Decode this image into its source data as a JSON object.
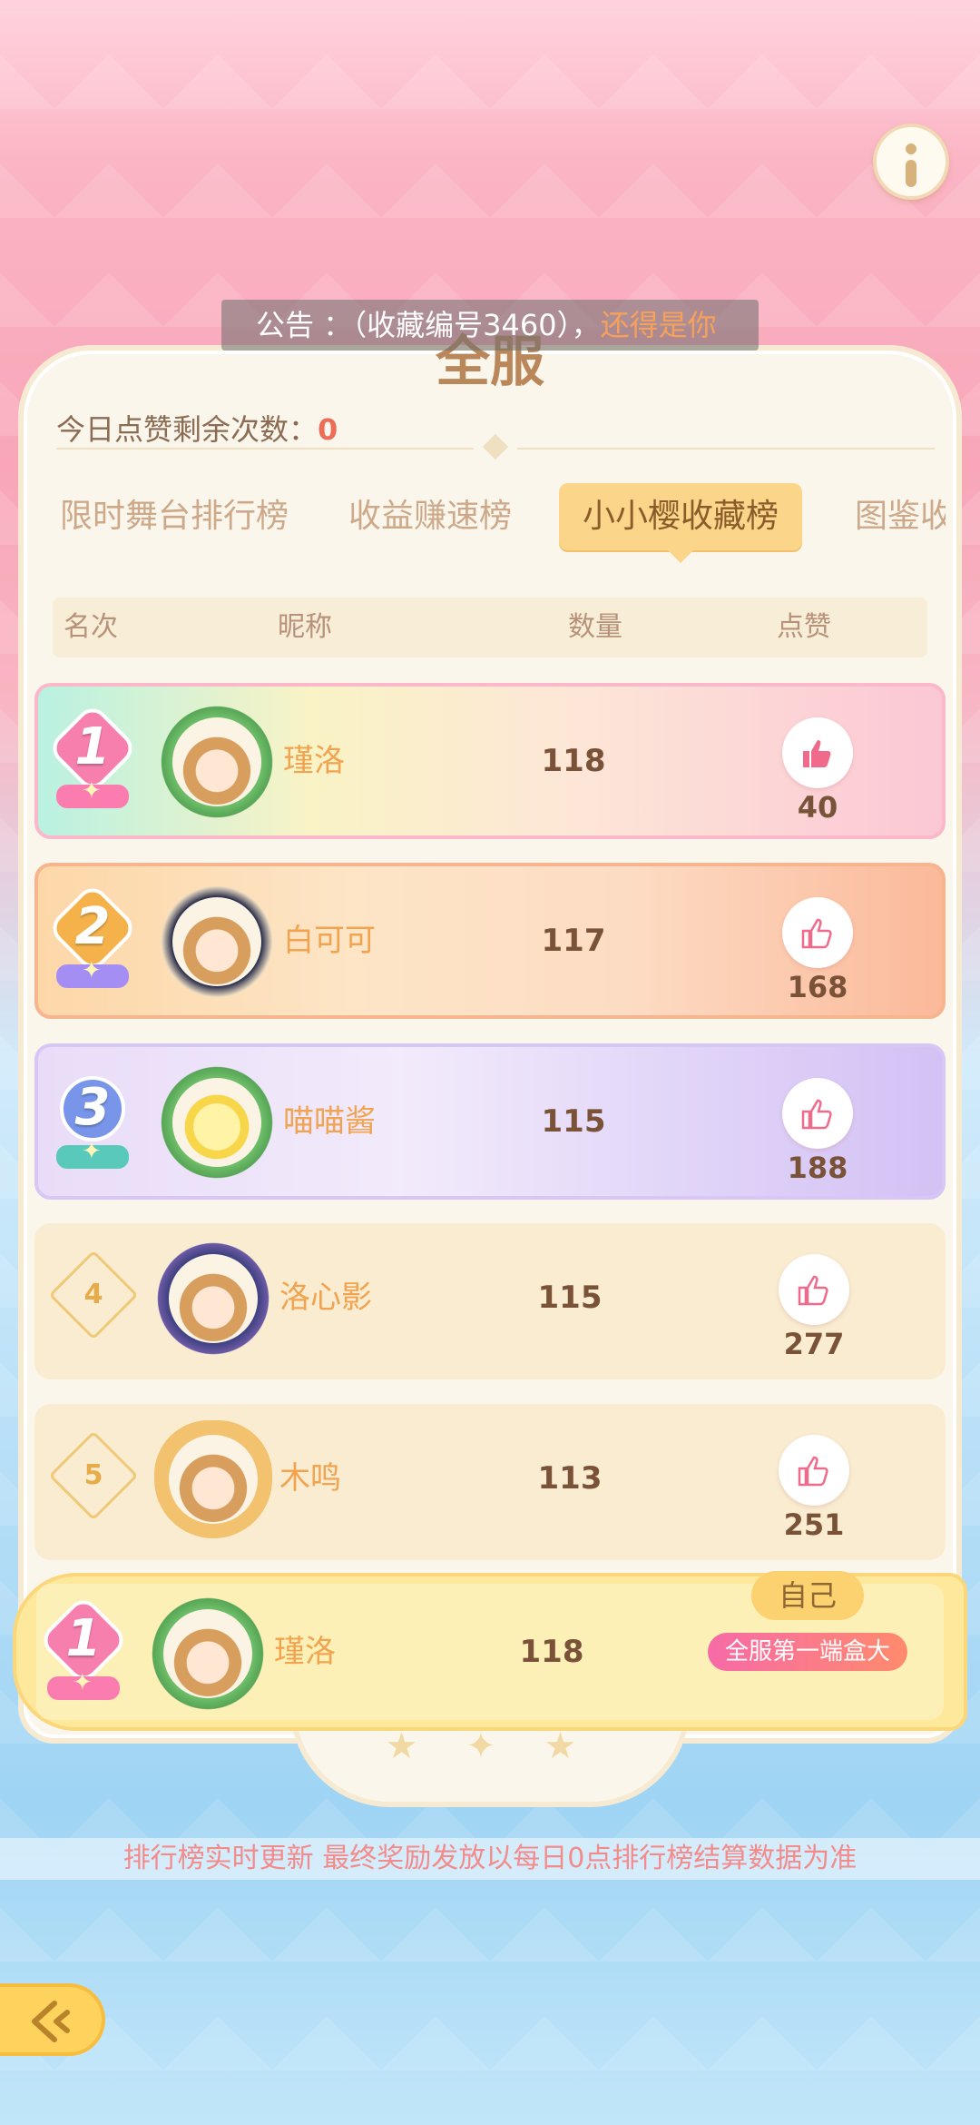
{
  "announcement": {
    "prefix": "公告 ：（收藏编号3460），",
    "highlight": "还得是你"
  },
  "panel": {
    "title": "全服"
  },
  "likes_remaining": {
    "label": "今日点赞剩余次数：",
    "value": "0"
  },
  "tabs": [
    {
      "label": "限时舞台排行榜",
      "active": false
    },
    {
      "label": "收益赚速榜",
      "active": false
    },
    {
      "label": "小小樱收藏榜",
      "active": true
    },
    {
      "label": "图鉴收",
      "active": false
    }
  ],
  "table_header": {
    "rank": "名次",
    "nickname": "昵称",
    "count": "数量",
    "likes": "点赞"
  },
  "rows": [
    {
      "rank": "1",
      "nickname": "瑾洛",
      "count": "118",
      "likes": "40"
    },
    {
      "rank": "2",
      "nickname": "白可可",
      "count": "117",
      "likes": "168"
    },
    {
      "rank": "3",
      "nickname": "喵喵酱",
      "count": "115",
      "likes": "188"
    },
    {
      "rank": "4",
      "nickname": "洛心影",
      "count": "115",
      "likes": "277"
    },
    {
      "rank": "5",
      "nickname": "木鸣",
      "count": "113",
      "likes": "251"
    }
  ],
  "self_row": {
    "tag": "自己",
    "rank": "1",
    "nickname": "瑾洛",
    "count": "118",
    "title_badge": "全服第一端盒大"
  },
  "footer_note": "排行榜实时更新 最终奖励发放以每日0点排行榜结算数据为准",
  "colors": {
    "rank1": "#f76aa7",
    "rank2": "#f4a83a",
    "rank3": "#6f8fe0",
    "accent_tab": "#fbd68a",
    "nickname": "#f2a34f"
  },
  "icons": {
    "info": "info-icon",
    "like": "thumbs-up-icon",
    "back": "back-arrow-icon"
  }
}
